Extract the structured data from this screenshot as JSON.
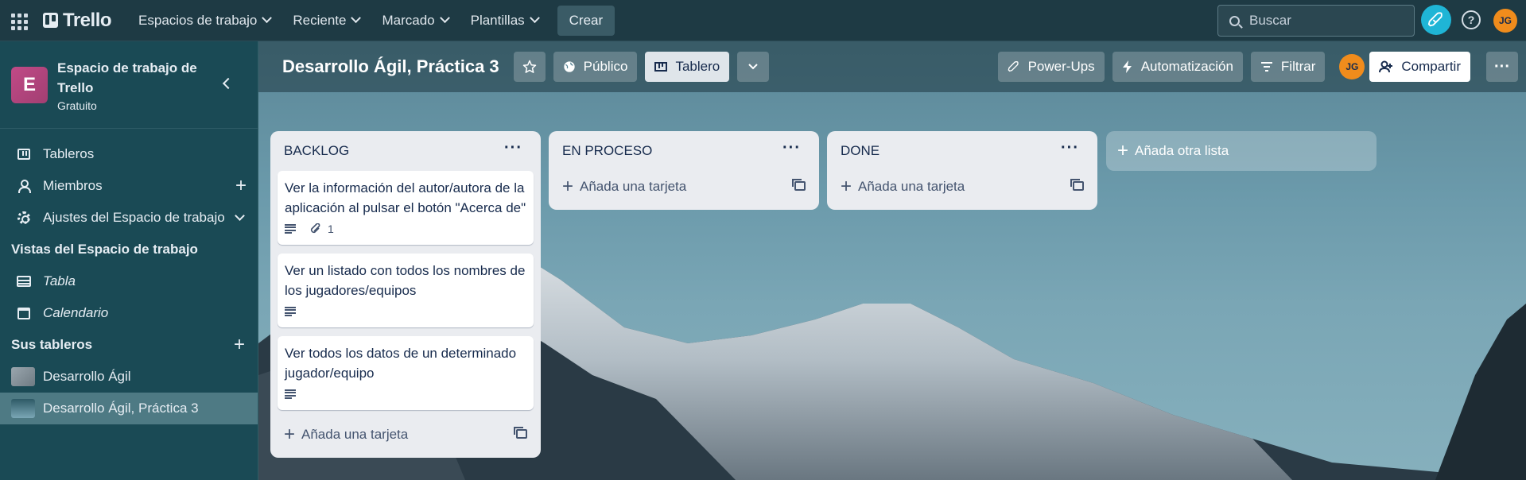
{
  "topnav": {
    "logo": "Trello",
    "menus": [
      "Espacios de trabajo",
      "Reciente",
      "Marcado",
      "Plantillas"
    ],
    "create": "Crear",
    "search_placeholder": "Buscar",
    "help": "?",
    "avatar": "JG"
  },
  "sidebar": {
    "workspace_initial": "E",
    "workspace_name": "Espacio de trabajo de Trello",
    "workspace_plan": "Gratuito",
    "items": [
      "Tableros",
      "Miembros",
      "Ajustes del Espacio de trabajo"
    ],
    "views_title": "Vistas del Espacio de trabajo",
    "views": [
      "Tabla",
      "Calendario"
    ],
    "boards_title": "Sus tableros",
    "boards": [
      "Desarrollo Ágil",
      "Desarrollo Ágil, Práctica 3"
    ]
  },
  "board": {
    "title": "Desarrollo Ágil, Práctica 3",
    "visibility": "Público",
    "view": "Tablero",
    "powerups": "Power-Ups",
    "automation": "Automatización",
    "filter": "Filtrar",
    "avatar": "JG",
    "share": "Compartir",
    "add_list": "Añada otra lista",
    "add_card": "Añada una tarjeta",
    "lists": [
      {
        "title": "BACKLOG",
        "cards": [
          {
            "text": "Ver la información del autor/autora de la aplicación al pulsar el botón \"Acerca de\"",
            "attachments": "1"
          },
          {
            "text": "Ver un listado con todos los nombres de los jugadores/equipos"
          },
          {
            "text": "Ver todos los datos de un determinado jugador/equipo"
          }
        ]
      },
      {
        "title": "EN PROCESO",
        "cards": []
      },
      {
        "title": "DONE",
        "cards": []
      }
    ]
  },
  "colors": {
    "nav_bg": "#1e3a44",
    "sidebar_bg": "#1a4a55",
    "workspace_badge": "#c04a87",
    "accent_rocket": "#1fb5d6",
    "avatar": "#f08c1c"
  }
}
